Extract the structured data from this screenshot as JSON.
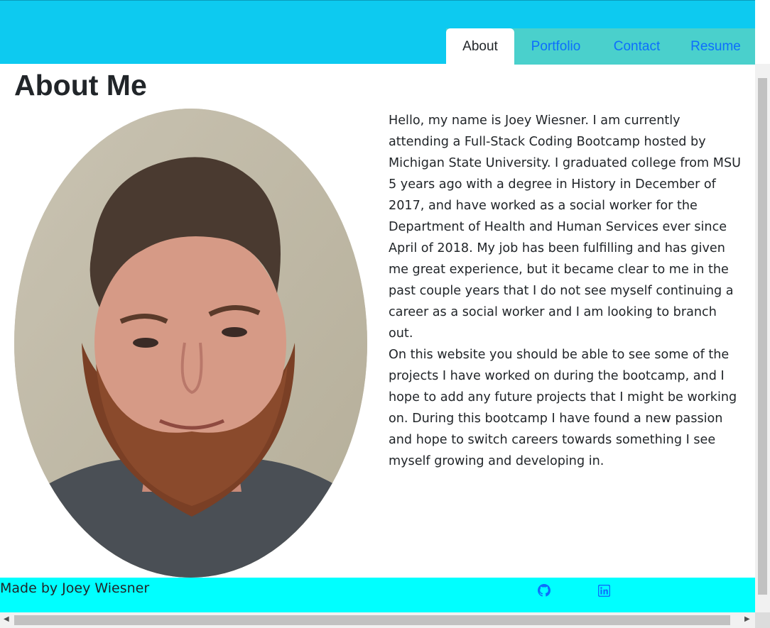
{
  "nav": {
    "tabs": [
      {
        "label": "About",
        "active": true
      },
      {
        "label": "Portfolio",
        "active": false
      },
      {
        "label": "Contact",
        "active": false
      },
      {
        "label": "Resume",
        "active": false
      }
    ]
  },
  "main": {
    "title": "About Me",
    "bio_paragraph_1": "Hello, my name is Joey Wiesner. I am currently attending a Full-Stack Coding Bootcamp hosted by Michigan State University. I graduated college from MSU 5 years ago with a degree in History in December of 2017, and have worked as a social worker for the Department of Health and Human Services ever since April of 2018. My job has been fulfilling and has given me great experience, but it became clear to me in the past couple years that I do not see myself continuing a career as a social worker and I am looking to branch out.",
    "bio_paragraph_2": "On this website you should be able to see some of the projects I have worked on during the bootcamp, and I hope to add any future projects that I might be working on. During this bootcamp I have found a new passion and hope to switch careers towards something I see myself growing and developing in."
  },
  "footer": {
    "text": "Made by Joey Wiesner",
    "icons": [
      "github-icon",
      "linkedin-icon"
    ]
  },
  "colors": {
    "header": "#0dcaf0",
    "tab_bar": "#4ad0cc",
    "footer": "#00ffff",
    "link": "#0d6efd"
  }
}
